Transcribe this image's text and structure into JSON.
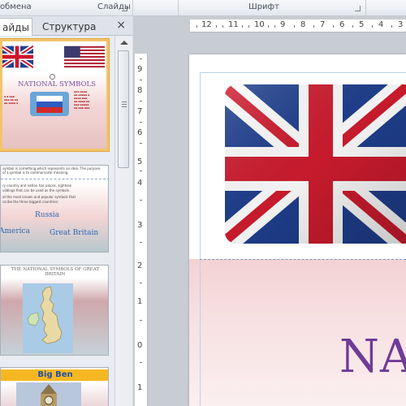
{
  "ribbon": {
    "groups": [
      "обмена",
      "Слайды",
      "Шрифт"
    ]
  },
  "panel": {
    "tab_slides": "айды",
    "tab_outline": "Структура",
    "close": "×"
  },
  "thumbnails": {
    "slide1_title": "NATIONAL SYMBOLS",
    "slide2_lines": [
      "symbol is something which represents an idea. The purpose",
      "of a symbol is to communicate meaning.",
      "ry country and nation has places, sightsee",
      "uildings that can be used as the symbols.",
      "at the most known and popular symbols that",
      "scribe the three biggest countries:"
    ],
    "slide2_words": [
      "Russia",
      "America",
      "Great Britain"
    ],
    "slide3_caption": "THE NATIONAL SYMBOLS OF GREAT BRITAIN",
    "slide4_title": "Big  Ben"
  },
  "rulers": {
    "horizontal": [
      "12",
      "11",
      "10",
      "9",
      "8",
      "7",
      "6",
      "5",
      "4",
      "3"
    ],
    "vertical": [
      "9",
      "8",
      "7",
      "6",
      "5",
      "4",
      "3",
      "2",
      "1",
      "0",
      "1"
    ]
  },
  "slide": {
    "title_fragment": "NA"
  },
  "colors": {
    "title": "#6f3b98",
    "selection": "#f3c46b",
    "accent_blue": "#2a6ab4"
  }
}
